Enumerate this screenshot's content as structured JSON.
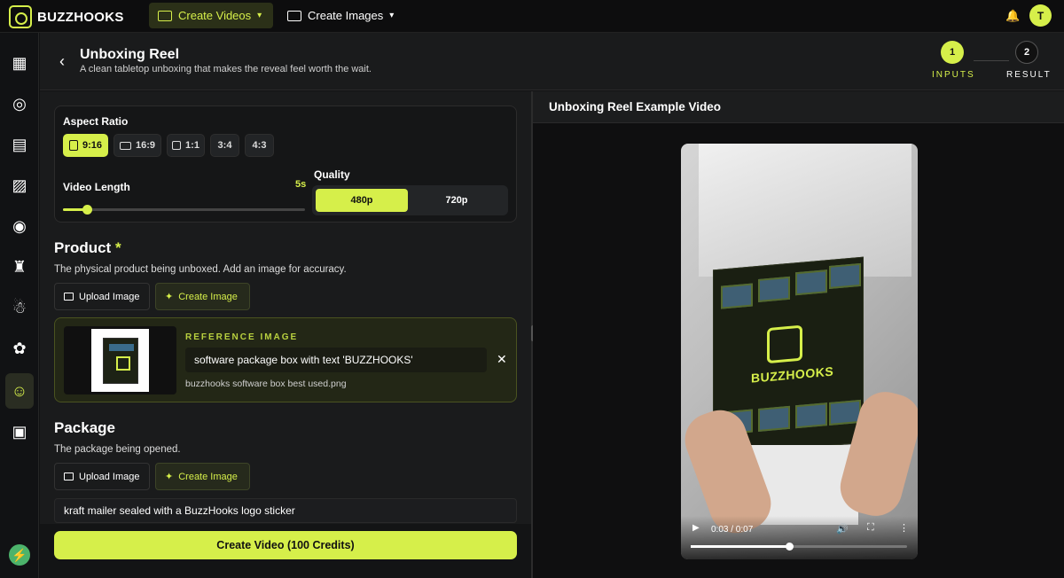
{
  "app": {
    "brand": "BUZZHOOKS",
    "user_initial": "T"
  },
  "topnav": {
    "create_videos": "Create Videos",
    "create_images": "Create Images"
  },
  "sidebar": {
    "icons": [
      "templates-icon",
      "film-reel-icon",
      "clapperboard-icon",
      "image-edit-icon",
      "video-camera-icon",
      "shirt-icon",
      "santa-icon",
      "dog-icon",
      "person-icon",
      "image-icon"
    ],
    "selected": "person-icon"
  },
  "header": {
    "title": "Unboxing Reel",
    "subtitle": "A clean tabletop unboxing that makes the reveal feel worth the wait."
  },
  "steps": [
    {
      "number": "1",
      "label": "INPUTS",
      "active": true
    },
    {
      "number": "2",
      "label": "RESULT",
      "active": false
    }
  ],
  "settings": {
    "aspect_ratio_label": "Aspect Ratio",
    "ratios": [
      "9:16",
      "16:9",
      "1:1",
      "3:4",
      "4:3"
    ],
    "selected_ratio": "9:16",
    "video_length_label": "Video Length",
    "video_length_value": "5s",
    "video_length_fraction": 0.1,
    "quality_label": "Quality",
    "qualities": [
      "480p",
      "720p"
    ],
    "selected_quality": "480p"
  },
  "product": {
    "title": "Product",
    "required_mark": "*",
    "description": "The physical product being unboxed. Add an image for accuracy.",
    "upload_label": "Upload Image",
    "create_label": "Create Image",
    "reference_label": "REFERENCE IMAGE",
    "reference_text": "software package box with text 'BUZZHOOKS'",
    "reference_file": "buzzhooks software box best used.png",
    "close_glyph": "✕"
  },
  "package": {
    "title": "Package",
    "description": "The package being opened.",
    "upload_label": "Upload Image",
    "create_label": "Create Image",
    "input_value": "kraft mailer sealed with a BuzzHooks logo sticker"
  },
  "cta": {
    "label": "Create Video (100 Credits)"
  },
  "preview": {
    "title": "Unboxing Reel Example Video",
    "time": "0:03 / 0:07",
    "progress_fraction": 0.455,
    "box_text": "BUZZHOOKS"
  },
  "colors": {
    "accent": "#d6ef4a",
    "bg": "#1a1b1c"
  }
}
